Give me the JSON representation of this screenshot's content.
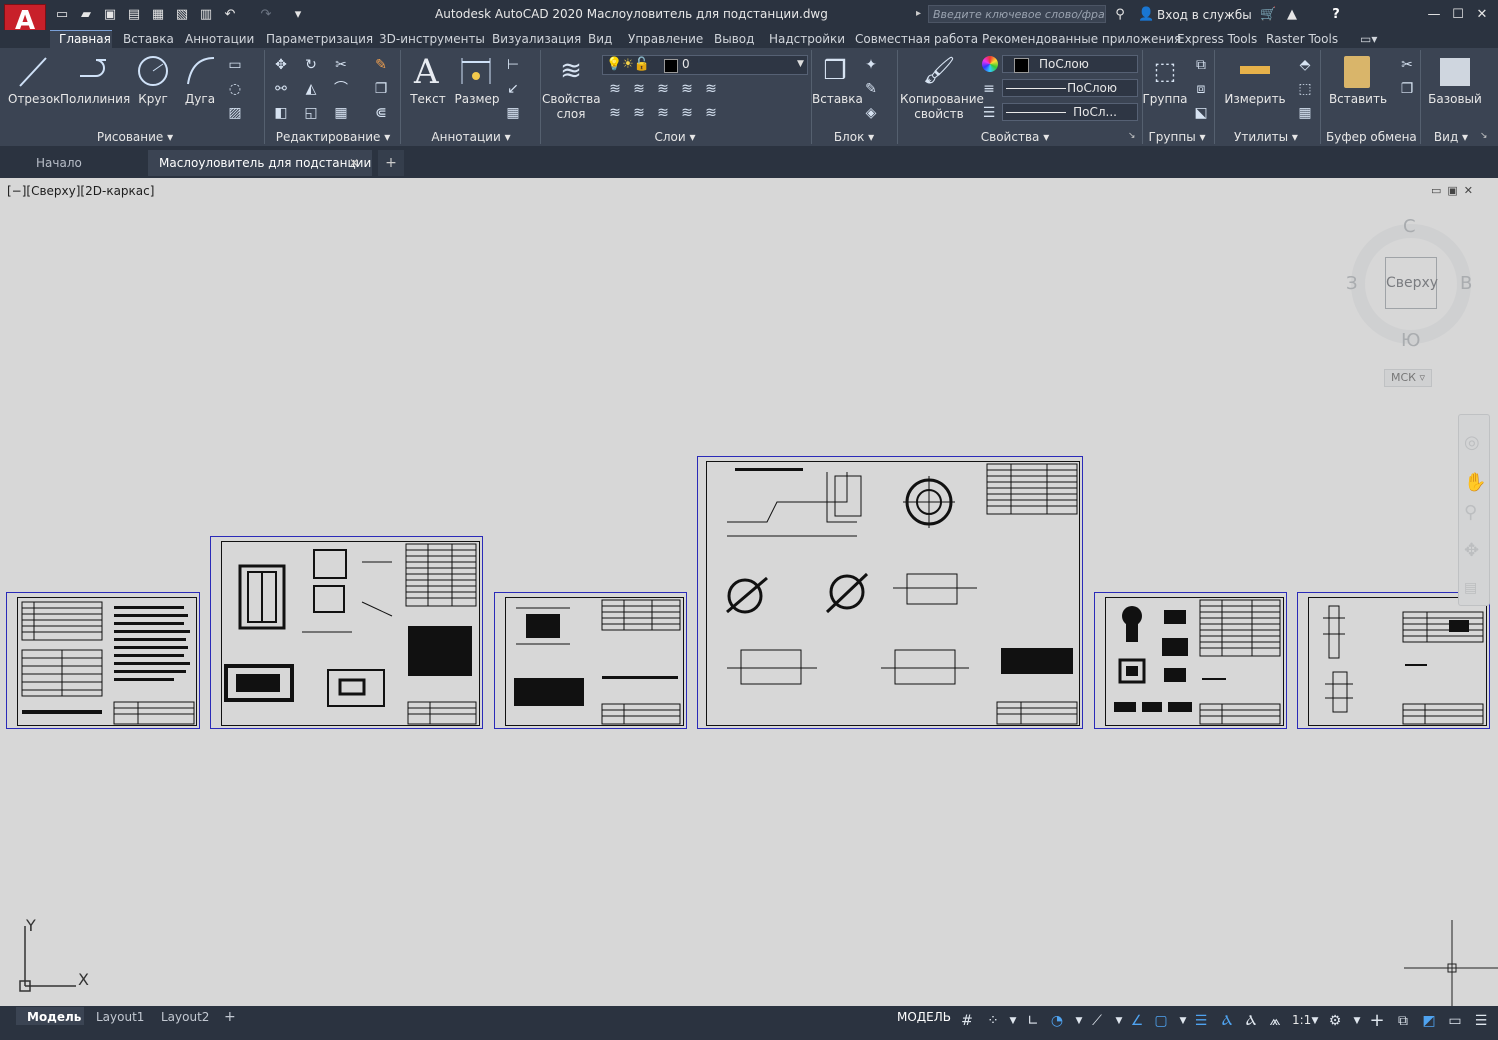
{
  "app": {
    "logo_letter": "A",
    "title": "Autodesk AutoCAD 2020   Маслоуловитель для подстанции.dwg",
    "search_placeholder": "Введите ключевое слово/фразу",
    "signin": "Вход в службы",
    "help": "?"
  },
  "ribbon_tabs": [
    "Главная",
    "Вставка",
    "Аннотации",
    "Параметризация",
    "3D-инструменты",
    "Визуализация",
    "Вид",
    "Управление",
    "Вывод",
    "Надстройки",
    "Совместная работа",
    "Рекомендованные приложения",
    "Express Tools",
    "Raster Tools"
  ],
  "draw_panel": {
    "line": "Отрезок",
    "polyline": "Полилиния",
    "circle": "Круг",
    "arc": "Дуга",
    "label": "Рисование"
  },
  "modify_panel": {
    "label": "Редактирование"
  },
  "annot_panel": {
    "text": "Текст",
    "dim": "Размер",
    "label": "Аннотации"
  },
  "layers_panel": {
    "props_l1": "Свойства",
    "props_l2": "слоя",
    "current_layer": "0",
    "label": "Слои"
  },
  "block_panel": {
    "insert": "Вставка",
    "label": "Блок"
  },
  "props_panel": {
    "match_l1": "Копирование",
    "match_l2": "свойств",
    "color": "ПоСлою",
    "linetype": "ПоСлою",
    "lineweight": "ПоСл...",
    "label": "Свойства"
  },
  "groups_panel": {
    "group": "Группа",
    "label": "Группы"
  },
  "util_panel": {
    "measure": "Измерить",
    "label": "Утилиты"
  },
  "clip_panel": {
    "paste": "Вставить",
    "label": "Буфер обмена"
  },
  "view_panel": {
    "base": "Базовый",
    "label": "Вид"
  },
  "doc_tabs": {
    "start": "Начало",
    "active": "Маслоуловитель для подстанции"
  },
  "viewport": {
    "label": "[−][Сверху][2D-каркас]"
  },
  "viewcube": {
    "n": "С",
    "s": "Ю",
    "w": "З",
    "e": "В",
    "face": "Сверху",
    "ucs": "МСК"
  },
  "ucs_icon": {
    "x": "X",
    "y": "Y"
  },
  "status": {
    "tabs": [
      "Модель",
      "Layout1",
      "Layout2"
    ],
    "model": "МОДЕЛЬ",
    "scale": "1:1"
  }
}
